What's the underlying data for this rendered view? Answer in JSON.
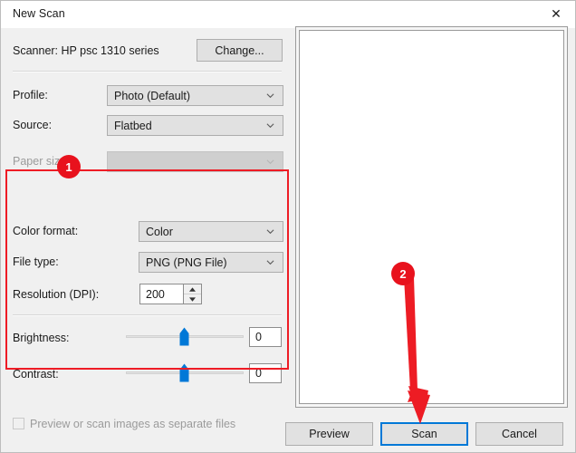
{
  "window": {
    "title": "New Scan",
    "close_icon": "close-icon"
  },
  "scanner_row": {
    "label": "Scanner: HP psc 1310 series",
    "change_button": "Change..."
  },
  "fields": [
    {
      "label": "Profile:",
      "value": "Photo (Default)",
      "type": "combo",
      "disabled": false
    },
    {
      "label": "Source:",
      "value": "Flatbed",
      "type": "combo",
      "disabled": false
    },
    {
      "label": "Paper size:",
      "value": "",
      "type": "combo",
      "disabled": true
    },
    {
      "label": "Color format:",
      "value": "Color",
      "type": "combo",
      "disabled": false
    },
    {
      "label": "File type:",
      "value": "PNG (PNG File)",
      "type": "combo",
      "disabled": false
    },
    {
      "label": "Resolution (DPI):",
      "value": "200",
      "type": "spinner",
      "disabled": false
    }
  ],
  "sliders": [
    {
      "label": "Brightness:",
      "value": "0",
      "percent": 50
    },
    {
      "label": "Contrast:",
      "value": "0",
      "percent": 50
    }
  ],
  "checkbox": {
    "label": "Preview or scan images as separate files",
    "checked": false,
    "disabled": true
  },
  "footer": {
    "preview_button": "Preview",
    "scan_button": "Scan",
    "cancel_button": "Cancel"
  },
  "annotations": {
    "badge_one": "1",
    "badge_two": "2",
    "highlight_color": "#ee1c25"
  },
  "colors": {
    "accent": "#0078d7",
    "slider_thumb": "#0078d7",
    "annotation_red": "#e8121d",
    "dialog_bg": "#f0f0f0"
  }
}
